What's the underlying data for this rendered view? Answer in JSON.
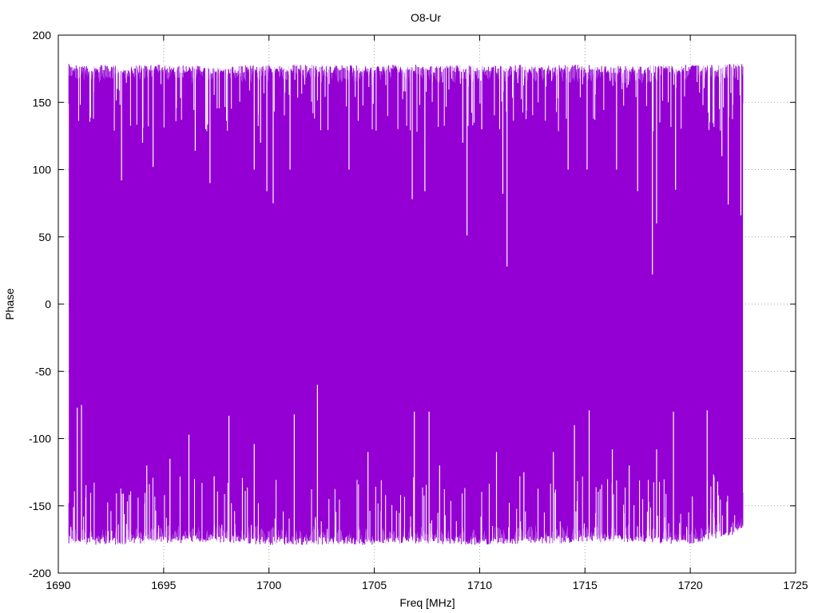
{
  "chart_data": {
    "type": "line",
    "title": "O8-Ur",
    "xlabel": "Freq [MHz]",
    "ylabel": "Phase",
    "xlim": [
      1690,
      1725
    ],
    "ylim": [
      -200,
      200
    ],
    "xticks": [
      "1690",
      "1695",
      "1700",
      "1705",
      "1710",
      "1715",
      "1720",
      "1725"
    ],
    "yticks": [
      "200",
      "150",
      "100",
      "50",
      "0",
      "-50",
      "-100",
      "-150",
      "-200"
    ],
    "grid": true,
    "series": [
      {
        "color": "#9400d3",
        "x_start": 1690.5,
        "x_end": 1722.5,
        "phase_min": -180,
        "phase_max": 180,
        "envelope_top": [
          [
            1690.5,
            179
          ],
          [
            1691.0,
            178
          ],
          [
            1692.0,
            178
          ],
          [
            1693.0,
            177
          ],
          [
            1694.0,
            178
          ],
          [
            1695.0,
            178
          ],
          [
            1697.0,
            177
          ],
          [
            1700.0,
            178
          ],
          [
            1703.0,
            178
          ],
          [
            1705.0,
            178
          ],
          [
            1707.0,
            178
          ],
          [
            1710.0,
            178
          ],
          [
            1712.0,
            178
          ],
          [
            1715.0,
            178
          ],
          [
            1717.0,
            177
          ],
          [
            1720.0,
            178
          ],
          [
            1722.5,
            179
          ]
        ],
        "envelope_bottom": [
          [
            1690.5,
            -178
          ],
          [
            1691.0,
            -179
          ],
          [
            1693.0,
            -179
          ],
          [
            1695.0,
            -178
          ],
          [
            1697.0,
            -177
          ],
          [
            1700.0,
            -179
          ],
          [
            1703.0,
            -179
          ],
          [
            1705.0,
            -179
          ],
          [
            1707.0,
            -178
          ],
          [
            1710.0,
            -179
          ],
          [
            1712.0,
            -178
          ],
          [
            1715.0,
            -178
          ],
          [
            1717.0,
            -177
          ],
          [
            1719.0,
            -179
          ],
          [
            1720.0,
            -179
          ],
          [
            1721.0,
            -175
          ],
          [
            1722.5,
            -170
          ]
        ],
        "dips_from_top": [
          [
            1692.8,
            160
          ],
          [
            1693.0,
            92
          ],
          [
            1694.0,
            120
          ],
          [
            1694.5,
            102
          ],
          [
            1696.5,
            114
          ],
          [
            1697.0,
            130
          ],
          [
            1697.2,
            90
          ],
          [
            1699.3,
            100
          ],
          [
            1699.6,
            120
          ],
          [
            1699.9,
            84
          ],
          [
            1700.2,
            75
          ],
          [
            1701.0,
            100
          ],
          [
            1703.8,
            100
          ],
          [
            1706.8,
            78
          ],
          [
            1707.4,
            84
          ],
          [
            1709.2,
            120
          ],
          [
            1709.4,
            51
          ],
          [
            1710.1,
            130
          ],
          [
            1711.1,
            82
          ],
          [
            1711.3,
            28
          ],
          [
            1714.2,
            100
          ],
          [
            1715.1,
            100
          ],
          [
            1716.5,
            100
          ],
          [
            1717.5,
            84
          ],
          [
            1718.2,
            22
          ],
          [
            1718.4,
            60
          ],
          [
            1719.3,
            85
          ],
          [
            1721.5,
            110
          ],
          [
            1721.8,
            74
          ],
          [
            1722.4,
            66
          ]
        ],
        "spikes_from_bottom": [
          [
            1690.9,
            -77
          ],
          [
            1691.1,
            -75
          ],
          [
            1694.2,
            -120
          ],
          [
            1695.3,
            -115
          ],
          [
            1696.2,
            -97
          ],
          [
            1697.4,
            -128
          ],
          [
            1698.1,
            -83
          ],
          [
            1699.3,
            -104
          ],
          [
            1701.2,
            -82
          ],
          [
            1702.3,
            -60
          ],
          [
            1704.7,
            -110
          ],
          [
            1706.9,
            -80
          ],
          [
            1707.6,
            -80
          ],
          [
            1708.1,
            -120
          ],
          [
            1710.8,
            -110
          ],
          [
            1712.1,
            -125
          ],
          [
            1713.5,
            -110
          ],
          [
            1714.5,
            -90
          ],
          [
            1715.2,
            -79
          ],
          [
            1716.3,
            -108
          ],
          [
            1717.1,
            -120
          ],
          [
            1718.4,
            -108
          ],
          [
            1719.2,
            -80
          ],
          [
            1720.8,
            -79
          ],
          [
            1721.3,
            -132
          ]
        ]
      }
    ]
  }
}
